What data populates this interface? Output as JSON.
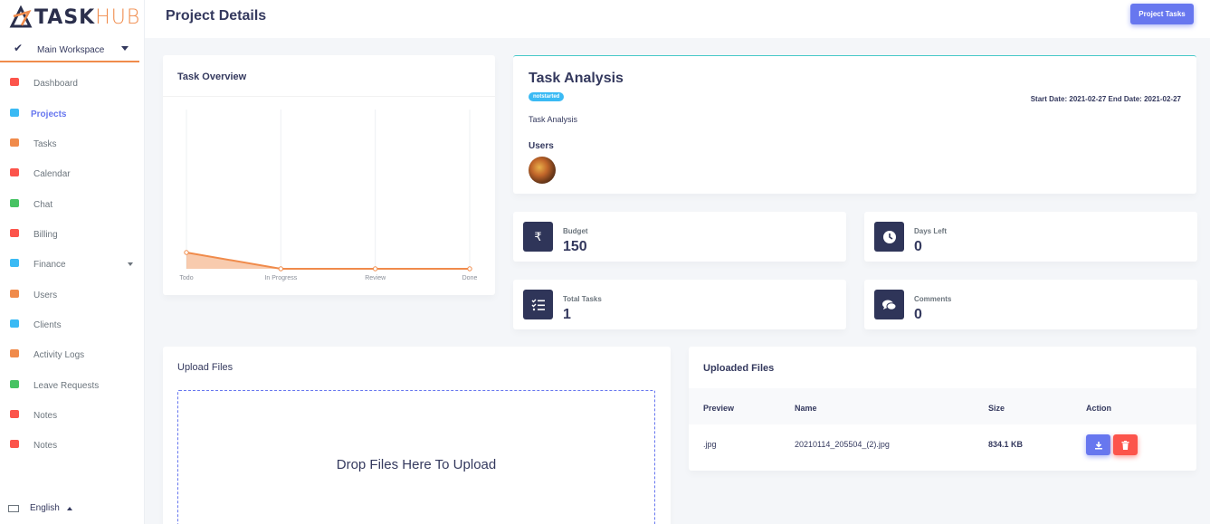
{
  "brand": {
    "task": "TASK",
    "hub": "HUB",
    "accent": "#f08b4b",
    "dark": "#2b2f4c"
  },
  "workspace": {
    "label": "Main Workspace",
    "icon": "check-icon"
  },
  "sidebar": {
    "items": [
      {
        "label": "Dashboard",
        "icon": "fire-icon",
        "color": "#fc544b"
      },
      {
        "label": "Projects",
        "icon": "briefcase-icon",
        "color": "#3abaf4"
      },
      {
        "label": "Tasks",
        "icon": "tasks-icon",
        "color": "#f08b4b"
      },
      {
        "label": "Calendar",
        "icon": "calendar-icon",
        "color": "#fc544b"
      },
      {
        "label": "Chat",
        "icon": "chat-icon",
        "color": "#47c363"
      },
      {
        "label": "Billing",
        "icon": "receipt-icon",
        "color": "#fc544b"
      },
      {
        "label": "Finance",
        "icon": "money-icon",
        "color": "#3abaf4"
      },
      {
        "label": "Users",
        "icon": "user-icon",
        "color": "#f08b4b"
      },
      {
        "label": "Clients",
        "icon": "users-icon",
        "color": "#3abaf4"
      },
      {
        "label": "Activity Logs",
        "icon": "chart-line-icon",
        "color": "#f08b4b"
      },
      {
        "label": "Leave Requests",
        "icon": "check-icon",
        "color": "#47c363"
      },
      {
        "label": "Notes",
        "icon": "note-icon",
        "color": "#fc544b"
      },
      {
        "label": "Notes",
        "icon": "note-icon",
        "color": "#fc544b"
      }
    ],
    "active": "Projects",
    "language": "English"
  },
  "header": {
    "title": "Project Details",
    "project_tasks_button": "Project Tasks"
  },
  "overview": {
    "title": "Task Overview"
  },
  "chart_data": {
    "type": "area",
    "categories": [
      "Todo",
      "In Progress",
      "Review",
      "Done"
    ],
    "values": [
      1,
      0,
      0,
      0
    ],
    "color": "#f08b4b",
    "grid": true
  },
  "analysis": {
    "name": "Task Analysis",
    "status": "notstarted",
    "dates": "Start Date: 2021-02-27 End Date: 2021-02-27",
    "description": "Task Analysis",
    "users_label": "Users"
  },
  "stats": {
    "budget": {
      "label": "Budget",
      "value": "150",
      "icon": "rupee-icon",
      "glyph": "₹"
    },
    "days_left": {
      "label": "Days Left",
      "value": "0",
      "icon": "clock-icon"
    },
    "total_tasks": {
      "label": "Total Tasks",
      "value": "1",
      "icon": "list-check-icon"
    },
    "comments": {
      "label": "Comments",
      "value": "0",
      "icon": "comments-icon"
    }
  },
  "upload": {
    "title": "Upload Files",
    "drop_text": "Drop Files Here To Upload"
  },
  "uploaded": {
    "title": "Uploaded Files",
    "headers": {
      "preview": "Preview",
      "name": "Name",
      "size": "Size",
      "action": "Action"
    },
    "rows": [
      {
        "preview": ".jpg",
        "name": "20210114_205504_(2).jpg",
        "size": "834.1 KB"
      }
    ]
  }
}
